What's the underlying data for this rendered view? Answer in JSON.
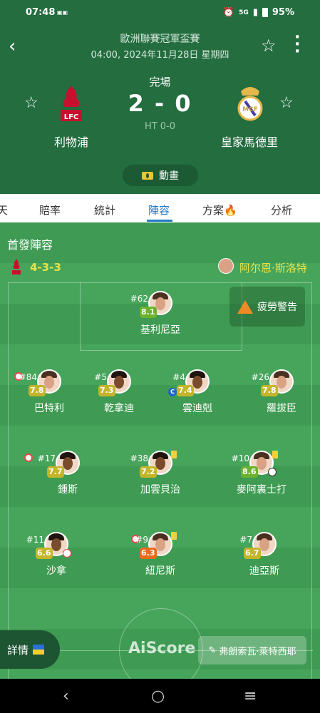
{
  "status_bar": {
    "time": "07:48",
    "notif_icon": "app-notification-icon",
    "signal_text": "5G",
    "battery": "95%"
  },
  "header": {
    "league": "歐洲聯賽冠軍盃賽",
    "datetime": "04:00, 2024年11月28日 星期四",
    "match_status": "完場",
    "score": "2 - 0",
    "half_time": "HT 0-0",
    "home_team": "利物浦",
    "away_team": "皇家馬德里",
    "home_color": "#c8102e",
    "away_color": "#e5b84b",
    "animation_label": "動畫"
  },
  "tabs": [
    {
      "label": "天"
    },
    {
      "label": "賠率"
    },
    {
      "label": "統計"
    },
    {
      "label": "陣容",
      "active": true
    },
    {
      "label": "方案🔥"
    },
    {
      "label": "分析"
    }
  ],
  "lineup": {
    "title": "首發陣容",
    "formation": "4-3-3",
    "coach": "阿尔恩·斯洛特",
    "fatigue_warning": "疲勞警告",
    "details_label": "詳情",
    "watermark": "AiScore",
    "referee": "弗朗索瓦·萊特西耶"
  },
  "players": [
    {
      "num": "#62",
      "rating": "8.1",
      "name": "基利尼亞",
      "rating_color": "green"
    },
    {
      "num": "#84",
      "rating": "7.8",
      "name": "巴特利",
      "rating_color": "yellow"
    },
    {
      "num": "#5",
      "rating": "7.3",
      "name": "乾拿迪",
      "rating_color": "yellow"
    },
    {
      "num": "#4",
      "rating": "7.4",
      "name": "雲迪剋",
      "rating_color": "yellow",
      "captain": "C"
    },
    {
      "num": "#26",
      "rating": "7.8",
      "name": "羅拔臣",
      "rating_color": "yellow"
    },
    {
      "num": "#17",
      "rating": "7.7",
      "name": "鍾斯",
      "rating_color": "yellow"
    },
    {
      "num": "#38",
      "rating": "7.2",
      "name": "加雲貝治",
      "rating_color": "yellow"
    },
    {
      "num": "#10",
      "rating": "8.6",
      "name": "麥阿裏士打",
      "rating_color": "green"
    },
    {
      "num": "#11",
      "rating": "6.6",
      "name": "沙拿",
      "rating_color": "yellow"
    },
    {
      "num": "#9",
      "rating": "6.3",
      "name": "紐尼斯",
      "rating_color": "orange"
    },
    {
      "num": "#7",
      "rating": "6.7",
      "name": "迪亞斯",
      "rating_color": "yellow"
    }
  ]
}
